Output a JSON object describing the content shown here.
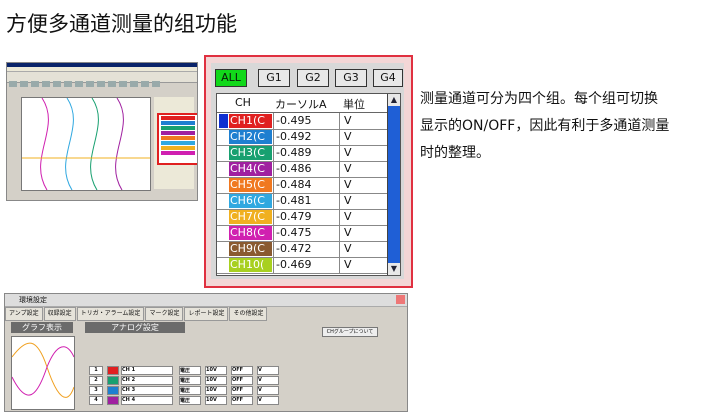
{
  "title": "方便多通道测量的组功能",
  "group_buttons": [
    "ALL",
    "G1",
    "G2",
    "G3",
    "G4"
  ],
  "table": {
    "headers": [
      "CH",
      "カーソルA",
      "単位"
    ],
    "rows": [
      {
        "ch": "CH1(C",
        "value": "-0.495",
        "unit": "V",
        "color": "#e02020",
        "sel": "#1030d0"
      },
      {
        "ch": "CH2(C",
        "value": "-0.492",
        "unit": "V",
        "color": "#1e7fd0",
        "sel": ""
      },
      {
        "ch": "CH3(C",
        "value": "-0.489",
        "unit": "V",
        "color": "#18a070",
        "sel": ""
      },
      {
        "ch": "CH4(C",
        "value": "-0.486",
        "unit": "V",
        "color": "#a020a0",
        "sel": ""
      },
      {
        "ch": "CH5(C",
        "value": "-0.484",
        "unit": "V",
        "color": "#f07820",
        "sel": ""
      },
      {
        "ch": "CH6(C",
        "value": "-0.481",
        "unit": "V",
        "color": "#30a8e0",
        "sel": ""
      },
      {
        "ch": "CH7(C",
        "value": "-0.479",
        "unit": "V",
        "color": "#f0b020",
        "sel": ""
      },
      {
        "ch": "CH8(C",
        "value": "-0.475",
        "unit": "V",
        "color": "#d020b0",
        "sel": ""
      },
      {
        "ch": "CH9(C",
        "value": "-0.472",
        "unit": "V",
        "color": "#8a5a30",
        "sel": ""
      },
      {
        "ch": "CH10(",
        "value": "-0.469",
        "unit": "V",
        "color": "#a8d020",
        "sel": ""
      }
    ]
  },
  "description": [
    "测量通道可分为四个组。每个组可切换",
    "显示的ON/OFF，因此有利于多通道测量",
    "时的整理。"
  ],
  "settings": {
    "window_title": "環境設定",
    "tabs": [
      "アンプ設定",
      "収録設定",
      "トリガ・アラーム設定",
      "マーク設定",
      "レポート設定",
      "その他設定"
    ],
    "graph_header": "グラフ表示",
    "analog_header": "アナログ設定",
    "group_button": "CHグループについて",
    "rows": [
      {
        "num": "1",
        "name": "CH 1",
        "color": "#e02020"
      },
      {
        "num": "2",
        "name": "CH 2",
        "color": "#18a070"
      },
      {
        "num": "3",
        "name": "CH 3",
        "color": "#1e7fd0"
      },
      {
        "num": "4",
        "name": "CH 4",
        "color": "#a020a0"
      }
    ],
    "input_value": "電圧",
    "range_value": "10V",
    "off_value": "OFF",
    "unit": "V"
  },
  "colors": {
    "all_button": "#11d81a",
    "zoom_border": "#e03040",
    "scrollbar": "#1f5fd6"
  }
}
